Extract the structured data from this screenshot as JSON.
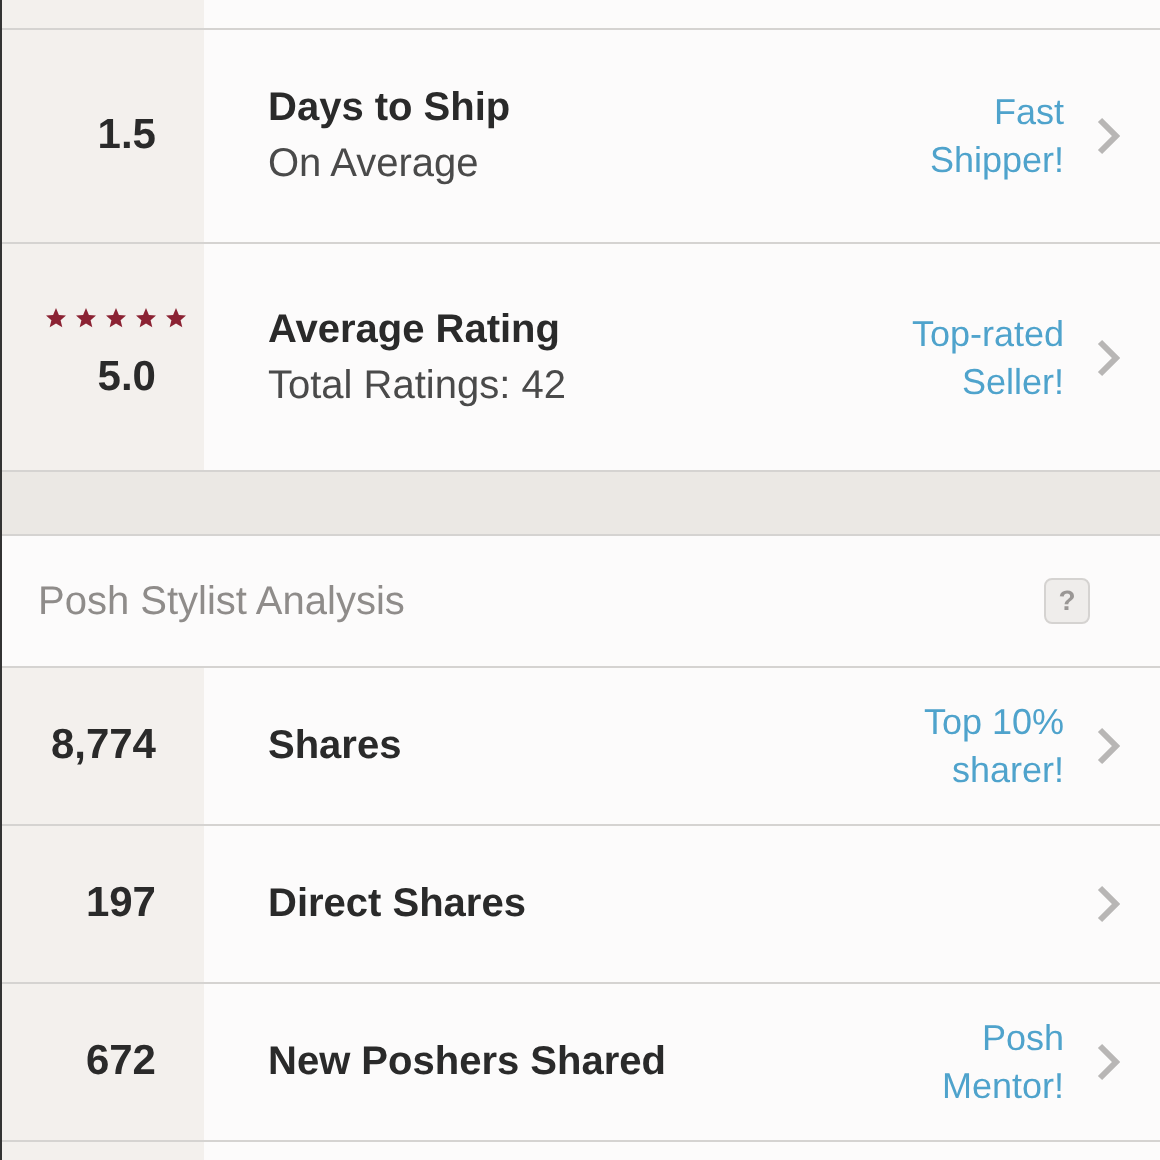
{
  "seller_stats": [
    {
      "value": "1.5",
      "title": "Days to Ship",
      "subtitle": "On Average",
      "badge": [
        "Fast",
        "Shipper!"
      ]
    },
    {
      "value": "5.0",
      "stars": 5,
      "title": "Average Rating",
      "subtitle": "Total Ratings: 42",
      "badge": [
        "Top-rated",
        "Seller!"
      ]
    }
  ],
  "analysis": {
    "title": "Posh Stylist Analysis",
    "help": "?",
    "rows": [
      {
        "value": "8,774",
        "title": "Shares",
        "badge": [
          "Top 10%",
          "sharer!"
        ]
      },
      {
        "value": "197",
        "title": "Direct Shares"
      },
      {
        "value": "672",
        "title": "New Poshers Shared",
        "badge": [
          "Posh",
          "Mentor!"
        ]
      }
    ]
  }
}
